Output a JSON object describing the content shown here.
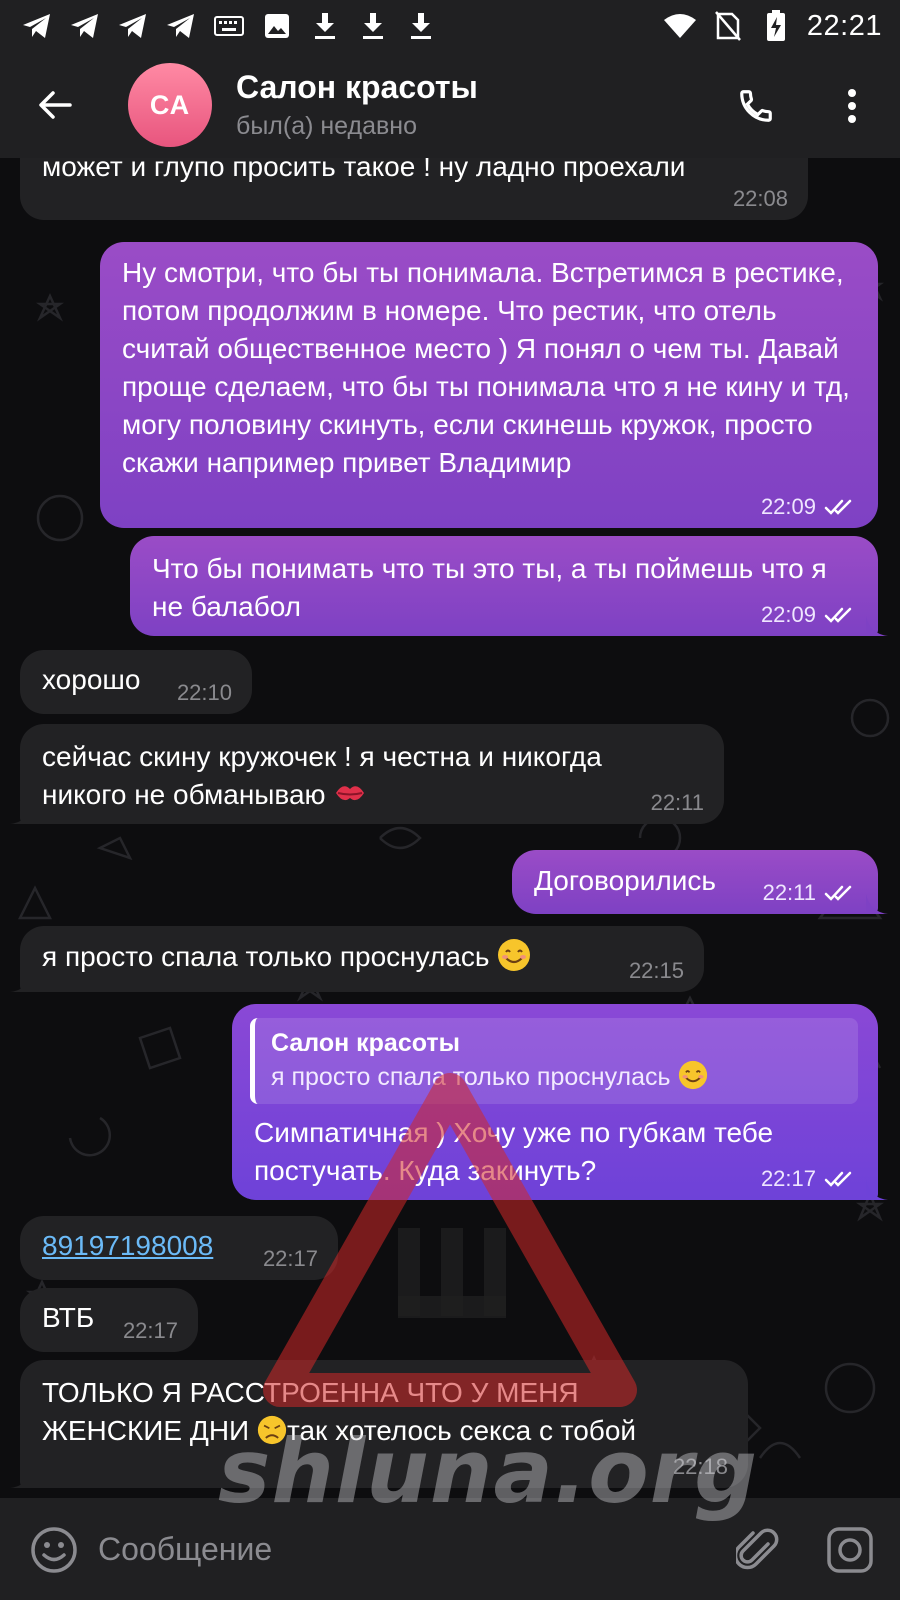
{
  "status_bar": {
    "time": "22:21",
    "left_icons": [
      "telegram-icon",
      "telegram-icon",
      "telegram-icon",
      "telegram-icon",
      "keyboard-icon",
      "image-icon",
      "download-icon",
      "download-icon",
      "download-icon"
    ],
    "right_icons": [
      "wifi-icon",
      "no-sim-icon",
      "battery-charging-icon"
    ]
  },
  "header": {
    "avatar_initials": "СА",
    "title": "Салон красоты",
    "status": "был(а) недавно",
    "avatar_color": "#f06e8e"
  },
  "messages": [
    {
      "dir": "in",
      "text": "может и глупо просить такое ! ну ладно проехали",
      "time": "22:08"
    },
    {
      "dir": "out",
      "text": "Ну смотри, что бы ты понимала. Встретимся в рестике, потом продолжим в номере. Что рестик, что отель считай общественное место ) Я понял о чем ты. Давай проще сделаем, что бы ты понимала что я не кину и тд, могу половину скинуть, если скинешь кружок, просто скажи например привет Владимир",
      "time": "22:09",
      "read": true
    },
    {
      "dir": "out",
      "text": "Что бы понимать что ты это ты, а ты поймешь что я не балабол",
      "time": "22:09",
      "read": true
    },
    {
      "dir": "in",
      "text": "хорошо",
      "time": "22:10"
    },
    {
      "dir": "in",
      "text": "сейчас скину кружочек ! я честна и никогда никого не обманываю",
      "emoji": "kiss-mark-emoji",
      "time": "22:11"
    },
    {
      "dir": "out",
      "text": "Договорились",
      "time": "22:11",
      "read": true
    },
    {
      "dir": "in",
      "text": "я просто спала только проснулась",
      "emoji": "smiling-face-emoji",
      "time": "22:15"
    },
    {
      "dir": "out",
      "reply_to": {
        "name": "Салон красоты",
        "text": "я просто спала только проснулась"
      },
      "text": "Симпатичная ) Хочу уже по губкам тебе постучать. Куда закинуть?",
      "time": "22:17",
      "read": true
    },
    {
      "dir": "in",
      "text": "89197198008",
      "is_link": true,
      "time": "22:17"
    },
    {
      "dir": "in",
      "text": "ВТБ",
      "time": "22:17"
    },
    {
      "dir": "in",
      "text_line1": "ТОЛЬКО Я РАССТРОЕННА ЧТО У МЕНЯ",
      "text_line2_a": "ЖЕНСКИЕ ДНИ",
      "text_line2_b": "так хотелось секса с тобой",
      "emoji": "disappointed-face-emoji",
      "time": "22:18"
    }
  ],
  "input": {
    "placeholder": "Сообщение"
  },
  "watermark": {
    "text": "shluna.org",
    "logo_letter": "Ш"
  },
  "colors": {
    "outgoing_bubble": "#8a46c6",
    "incoming_bubble": "#222224",
    "bar_background": "#202022",
    "link": "#6bbaf7"
  }
}
